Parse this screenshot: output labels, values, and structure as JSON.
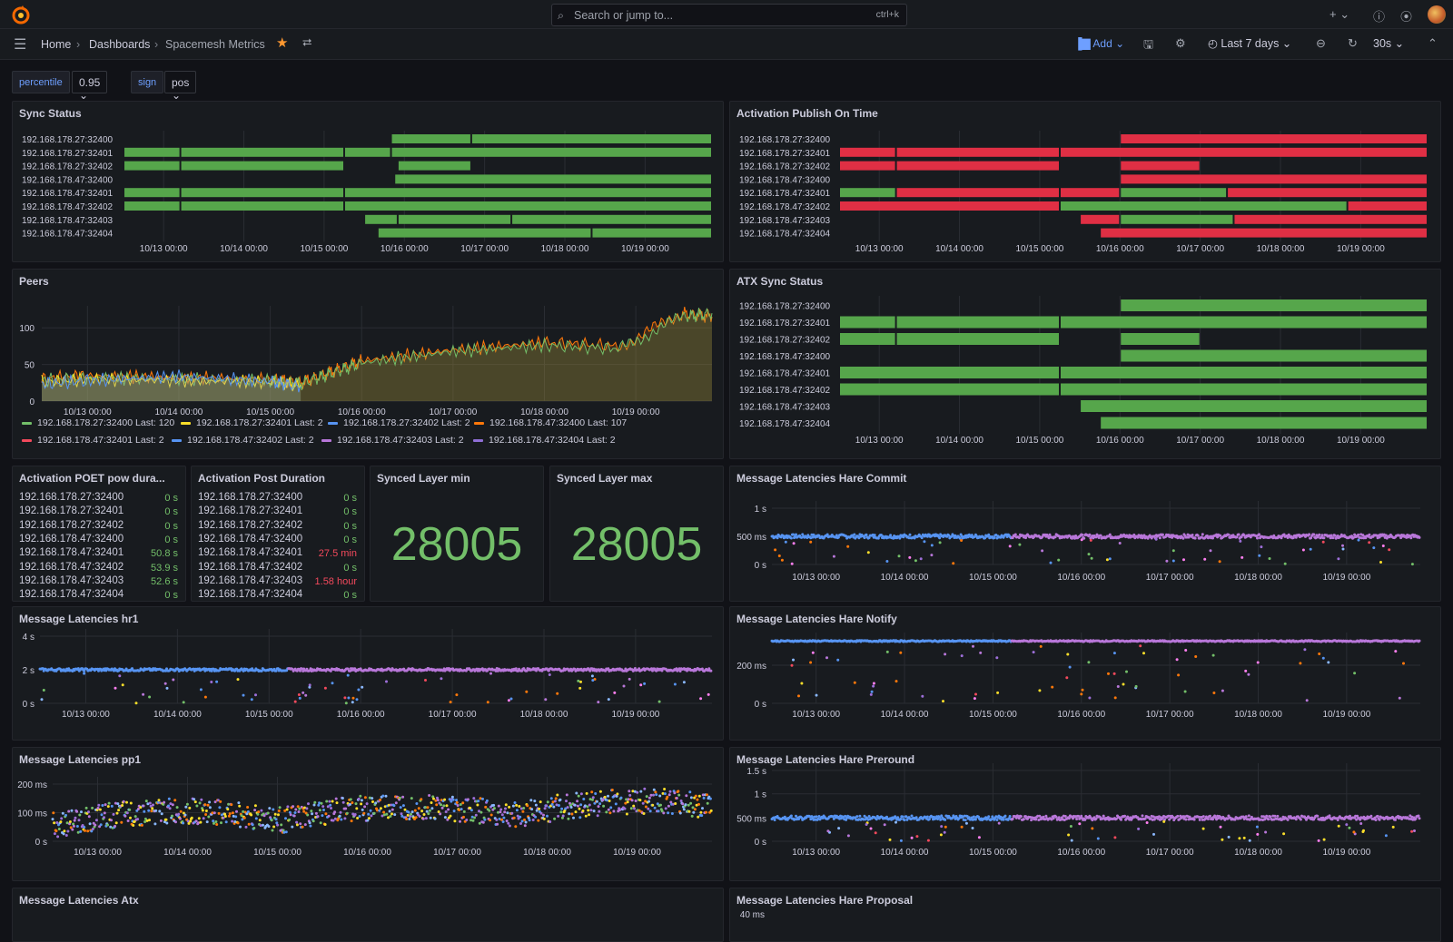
{
  "topbar": {
    "search_placeholder": "Search or jump to...",
    "search_shortcut": "ctrl+k",
    "add_icon": "plus-icon",
    "help_icon": "help-icon",
    "news_icon": "rss-icon"
  },
  "breadcrumb": {
    "home": "Home",
    "dashboards": "Dashboards",
    "current": "Spacemesh Metrics"
  },
  "toolbar": {
    "add_label": "Add",
    "time_range": "Last 7 days",
    "refresh": "30s"
  },
  "variables": [
    {
      "name": "percentile",
      "value": "0.95"
    },
    {
      "name": "sign",
      "value": "pos"
    }
  ],
  "time_ticks": [
    "10/13 00:00",
    "10/14 00:00",
    "10/15 00:00",
    "10/16 00:00",
    "10/17 00:00",
    "10/18 00:00",
    "10/19 00:00"
  ],
  "hosts": [
    "192.168.178.27:32400",
    "192.168.178.27:32401",
    "192.168.178.27:32402",
    "192.168.178.47:32400",
    "192.168.178.47:32401",
    "192.168.178.47:32402",
    "192.168.178.47:32403",
    "192.168.178.47:32404"
  ],
  "panels": {
    "sync_status": {
      "title": "Sync Status",
      "colors": {
        "ok": "#56a64b",
        "bad": "#e02f44"
      }
    },
    "activation_publish": {
      "title": "Activation Publish On Time"
    },
    "peers": {
      "title": "Peers",
      "yticks": [
        "100",
        "50",
        "0"
      ],
      "legend": [
        {
          "label": "192.168.178.27:32400",
          "last": "Last: 120",
          "color": "#73bf69"
        },
        {
          "label": "192.168.178.27:32401",
          "last": "Last: 2",
          "color": "#fade2a"
        },
        {
          "label": "192.168.178.27:32402",
          "last": "Last: 2",
          "color": "#5794f2"
        },
        {
          "label": "192.168.178.47:32400",
          "last": "Last: 107",
          "color": "#ff780a"
        },
        {
          "label": "192.168.178.47:32401",
          "last": "Last: 2",
          "color": "#f2495c"
        },
        {
          "label": "192.168.178.47:32402",
          "last": "Last: 2",
          "color": "#5794f2"
        },
        {
          "label": "192.168.178.47:32403",
          "last": "Last: 2",
          "color": "#b877d9"
        },
        {
          "label": "192.168.178.47:32404",
          "last": "Last: 2",
          "color": "#8f6fd6"
        }
      ]
    },
    "atx_sync": {
      "title": "ATX Sync Status"
    },
    "poet_pow": {
      "title": "Activation POET pow dura...",
      "values": [
        {
          "host": "192.168.178.27:32400",
          "value": "0 s",
          "color": "#73bf69"
        },
        {
          "host": "192.168.178.27:32401",
          "value": "0 s",
          "color": "#73bf69"
        },
        {
          "host": "192.168.178.27:32402",
          "value": "0 s",
          "color": "#73bf69"
        },
        {
          "host": "192.168.178.47:32400",
          "value": "0 s",
          "color": "#73bf69"
        },
        {
          "host": "192.168.178.47:32401",
          "value": "50.8 s",
          "color": "#73bf69"
        },
        {
          "host": "192.168.178.47:32402",
          "value": "53.9 s",
          "color": "#73bf69"
        },
        {
          "host": "192.168.178.47:32403",
          "value": "52.6 s",
          "color": "#73bf69"
        },
        {
          "host": "192.168.178.47:32404",
          "value": "0 s",
          "color": "#73bf69"
        }
      ]
    },
    "post_duration": {
      "title": "Activation Post Duration",
      "values": [
        {
          "host": "192.168.178.27:32400",
          "value": "0 s",
          "color": "#73bf69"
        },
        {
          "host": "192.168.178.27:32401",
          "value": "0 s",
          "color": "#73bf69"
        },
        {
          "host": "192.168.178.27:32402",
          "value": "0 s",
          "color": "#73bf69"
        },
        {
          "host": "192.168.178.47:32400",
          "value": "0 s",
          "color": "#73bf69"
        },
        {
          "host": "192.168.178.47:32401",
          "value": "27.5 min",
          "color": "#f2495c"
        },
        {
          "host": "192.168.178.47:32402",
          "value": "0 s",
          "color": "#73bf69"
        },
        {
          "host": "192.168.178.47:32403",
          "value": "1.58 hour",
          "color": "#f2495c"
        },
        {
          "host": "192.168.178.47:32404",
          "value": "0 s",
          "color": "#73bf69"
        }
      ]
    },
    "synced_min": {
      "title": "Synced Layer min",
      "value": "28005"
    },
    "synced_max": {
      "title": "Synced Layer max",
      "value": "28005"
    },
    "hare_commit": {
      "title": "Message Latencies Hare Commit",
      "yticks": [
        "1 s",
        "500 ms",
        "0 s"
      ]
    },
    "hr1": {
      "title": "Message Latencies hr1",
      "yticks": [
        "4 s",
        "2 s",
        "0 s"
      ]
    },
    "hare_notify": {
      "title": "Message Latencies Hare Notify",
      "yticks": [
        "200 ms",
        "0 s"
      ]
    },
    "pp1": {
      "title": "Message Latencies pp1",
      "yticks": [
        "200 ms",
        "100 ms",
        "0 s"
      ]
    },
    "hare_preround": {
      "title": "Message Latencies Hare Preround",
      "yticks": [
        "1.5 s",
        "1 s",
        "500 ms",
        "0 s"
      ]
    },
    "atx": {
      "title": "Message Latencies Atx"
    },
    "hare_proposal": {
      "title": "Message Latencies Hare Proposal",
      "yticks": [
        "40 ms"
      ]
    }
  },
  "chart_data": [
    {
      "type": "state-timeline",
      "title": "Sync Status",
      "x_range": [
        "10/12 12:00",
        "10/19 20:00"
      ],
      "rows": [
        {
          "name": "192.168.178.27:32400",
          "segments": [
            {
              "from": "10/15 20:00",
              "to": "10/16 20:00",
              "state": "ok"
            },
            {
              "from": "10/16 20:00",
              "to": "10/19 20:00",
              "state": "ok"
            }
          ]
        },
        {
          "name": "192.168.178.27:32401",
          "segments": [
            {
              "from": "10/12 12:00",
              "to": "10/13 05:00",
              "state": "ok"
            },
            {
              "from": "10/13 05:00",
              "to": "10/15 06:00",
              "state": "ok"
            },
            {
              "from": "10/15 06:00",
              "to": "10/15 20:00",
              "state": "ok"
            },
            {
              "from": "10/15 20:00",
              "to": "10/19 20:00",
              "state": "ok"
            }
          ]
        },
        {
          "name": "192.168.178.27:32402",
          "segments": [
            {
              "from": "10/12 12:00",
              "to": "10/13 05:00",
              "state": "ok"
            },
            {
              "from": "10/13 05:00",
              "to": "10/15 06:00",
              "state": "ok"
            },
            {
              "from": "10/15 22:00",
              "to": "10/16 20:00",
              "state": "ok"
            }
          ]
        },
        {
          "name": "192.168.178.47:32400",
          "segments": [
            {
              "from": "10/15 21:00",
              "to": "10/19 20:00",
              "state": "ok"
            }
          ]
        },
        {
          "name": "192.168.178.47:32401",
          "segments": [
            {
              "from": "10/12 12:00",
              "to": "10/13 05:00",
              "state": "ok"
            },
            {
              "from": "10/13 05:00",
              "to": "10/15 06:00",
              "state": "ok"
            },
            {
              "from": "10/15 06:00",
              "to": "10/19 20:00",
              "state": "ok"
            }
          ]
        },
        {
          "name": "192.168.178.47:32402",
          "segments": [
            {
              "from": "10/12 12:00",
              "to": "10/13 05:00",
              "state": "ok"
            },
            {
              "from": "10/13 05:00",
              "to": "10/15 06:00",
              "state": "ok"
            },
            {
              "from": "10/15 06:00",
              "to": "10/19 20:00",
              "state": "ok"
            }
          ]
        },
        {
          "name": "192.168.178.47:32403",
          "segments": [
            {
              "from": "10/15 12:00",
              "to": "10/15 22:00",
              "state": "ok"
            },
            {
              "from": "10/15 22:00",
              "to": "10/17 08:00",
              "state": "ok"
            },
            {
              "from": "10/17 08:00",
              "to": "10/19 20:00",
              "state": "ok"
            }
          ]
        },
        {
          "name": "192.168.178.47:32404",
          "segments": [
            {
              "from": "10/15 16:00",
              "to": "10/18 08:00",
              "state": "ok"
            },
            {
              "from": "10/18 08:00",
              "to": "10/19 20:00",
              "state": "ok"
            }
          ]
        }
      ]
    },
    {
      "type": "state-timeline",
      "title": "Activation Publish On Time",
      "rows": [
        {
          "name": "192.168.178.27:32400",
          "segments": [
            {
              "from": "10/16 00:00",
              "to": "10/19 20:00",
              "state": "bad"
            }
          ]
        },
        {
          "name": "192.168.178.27:32401",
          "segments": [
            {
              "from": "10/12 12:00",
              "to": "10/13 05:00",
              "state": "bad"
            },
            {
              "from": "10/13 05:00",
              "to": "10/15 06:00",
              "state": "bad"
            },
            {
              "from": "10/15 06:00",
              "to": "10/19 20:00",
              "state": "bad"
            }
          ]
        },
        {
          "name": "192.168.178.27:32402",
          "segments": [
            {
              "from": "10/12 12:00",
              "to": "10/13 05:00",
              "state": "bad"
            },
            {
              "from": "10/13 05:00",
              "to": "10/15 06:00",
              "state": "bad"
            },
            {
              "from": "10/16 00:00",
              "to": "10/17 00:00",
              "state": "bad"
            }
          ]
        },
        {
          "name": "192.168.178.47:32400",
          "segments": [
            {
              "from": "10/16 00:00",
              "to": "10/19 20:00",
              "state": "bad"
            }
          ]
        },
        {
          "name": "192.168.178.47:32401",
          "segments": [
            {
              "from": "10/12 12:00",
              "to": "10/13 05:00",
              "state": "ok"
            },
            {
              "from": "10/13 05:00",
              "to": "10/15 06:00",
              "state": "bad"
            },
            {
              "from": "10/15 06:00",
              "to": "10/16 00:00",
              "state": "bad"
            },
            {
              "from": "10/16 00:00",
              "to": "10/17 08:00",
              "state": "ok"
            },
            {
              "from": "10/17 08:00",
              "to": "10/19 20:00",
              "state": "bad"
            }
          ]
        },
        {
          "name": "192.168.178.47:32402",
          "segments": [
            {
              "from": "10/12 12:00",
              "to": "10/15 06:00",
              "state": "bad"
            },
            {
              "from": "10/15 06:00",
              "to": "10/18 20:00",
              "state": "ok"
            },
            {
              "from": "10/18 20:00",
              "to": "10/19 20:00",
              "state": "bad"
            }
          ]
        },
        {
          "name": "192.168.178.47:32403",
          "segments": [
            {
              "from": "10/15 12:00",
              "to": "10/16 00:00",
              "state": "bad"
            },
            {
              "from": "10/16 00:00",
              "to": "10/17 10:00",
              "state": "ok"
            },
            {
              "from": "10/17 10:00",
              "to": "10/19 20:00",
              "state": "bad"
            }
          ]
        },
        {
          "name": "192.168.178.47:32404",
          "segments": [
            {
              "from": "10/15 18:00",
              "to": "10/19 20:00",
              "state": "bad"
            }
          ]
        }
      ]
    },
    {
      "type": "state-timeline",
      "title": "ATX Sync Status",
      "rows": [
        {
          "name": "192.168.178.27:32400",
          "segments": [
            {
              "from": "10/16 00:00",
              "to": "10/19 20:00",
              "state": "ok"
            }
          ]
        },
        {
          "name": "192.168.178.27:32401",
          "segments": [
            {
              "from": "10/12 12:00",
              "to": "10/13 05:00",
              "state": "ok"
            },
            {
              "from": "10/13 05:00",
              "to": "10/15 06:00",
              "state": "ok"
            },
            {
              "from": "10/15 06:00",
              "to": "10/19 20:00",
              "state": "ok"
            }
          ]
        },
        {
          "name": "192.168.178.27:32402",
          "segments": [
            {
              "from": "10/12 12:00",
              "to": "10/13 05:00",
              "state": "ok"
            },
            {
              "from": "10/13 05:00",
              "to": "10/15 06:00",
              "state": "ok"
            },
            {
              "from": "10/16 00:00",
              "to": "10/17 00:00",
              "state": "ok"
            }
          ]
        },
        {
          "name": "192.168.178.47:32400",
          "segments": [
            {
              "from": "10/16 00:00",
              "to": "10/19 20:00",
              "state": "ok"
            }
          ]
        },
        {
          "name": "192.168.178.47:32401",
          "segments": [
            {
              "from": "10/12 12:00",
              "to": "10/15 06:00",
              "state": "ok"
            },
            {
              "from": "10/15 06:00",
              "to": "10/19 20:00",
              "state": "ok"
            }
          ]
        },
        {
          "name": "192.168.178.47:32402",
          "segments": [
            {
              "from": "10/12 12:00",
              "to": "10/15 06:00",
              "state": "ok"
            },
            {
              "from": "10/15 06:00",
              "to": "10/19 20:00",
              "state": "ok"
            }
          ]
        },
        {
          "name": "192.168.178.47:32403",
          "segments": [
            {
              "from": "10/15 12:00",
              "to": "10/19 20:00",
              "state": "ok"
            }
          ]
        },
        {
          "name": "192.168.178.47:32404",
          "segments": [
            {
              "from": "10/15 18:00",
              "to": "10/19 20:00",
              "state": "ok"
            }
          ]
        }
      ]
    },
    {
      "type": "area",
      "title": "Peers",
      "ylim": [
        0,
        130
      ],
      "series": [
        {
          "name": "192.168.178.47:32400",
          "x": [
            "10/12 12:00",
            "10/13 00:00",
            "10/14 00:00",
            "10/15 00:00",
            "10/15 08:00",
            "10/15 16:00",
            "10/16 00:00",
            "10/17 00:00",
            "10/18 00:00",
            "10/18 20:00",
            "10/19 12:00",
            "10/19 20:00"
          ],
          "y": [
            30,
            35,
            32,
            30,
            25,
            40,
            55,
            70,
            80,
            75,
            120,
            115
          ]
        },
        {
          "name": "192.168.178.27:32400",
          "x": [
            "10/12 12:00",
            "10/13 00:00",
            "10/14 00:00",
            "10/15 00:00",
            "10/15 08:00",
            "10/15 16:00",
            "10/16 00:00",
            "10/17 00:00",
            "10/18 00:00",
            "10/18 20:00",
            "10/19 12:00",
            "10/19 20:00"
          ],
          "y": [
            28,
            32,
            30,
            28,
            24,
            38,
            52,
            68,
            76,
            72,
            115,
            120
          ]
        },
        {
          "name": "192.168.178.27:32401",
          "x": [
            "10/12 12:00",
            "10/13 00:00",
            "10/14 00:00",
            "10/15 00:00",
            "10/15 08:00"
          ],
          "y": [
            26,
            30,
            28,
            26,
            22
          ]
        },
        {
          "name": "192.168.178.27:32402",
          "x": [
            "10/12 12:00",
            "10/13 00:00",
            "10/14 00:00",
            "10/15 00:00",
            "10/15 08:00"
          ],
          "y": [
            24,
            28,
            34,
            27,
            20
          ]
        }
      ]
    },
    {
      "type": "scatter",
      "title": "Message Latencies Hare Commit",
      "series": [
        {
          "name": "hosts",
          "typical_ms": [
            450,
            500
          ]
        }
      ]
    },
    {
      "type": "scatter",
      "title": "Message Latencies hr1",
      "series": [
        {
          "name": "hosts",
          "typical_s": [
            2,
            2.1
          ]
        }
      ]
    },
    {
      "type": "scatter",
      "title": "Message Latencies Hare Notify",
      "series": [
        {
          "name": "hosts",
          "typical_ms": [
            280
          ]
        }
      ]
    },
    {
      "type": "scatter",
      "title": "Message Latencies pp1",
      "series": [
        {
          "name": "hosts",
          "typical_ms": [
            50,
            150
          ]
        }
      ]
    },
    {
      "type": "scatter",
      "title": "Message Latencies Hare Preround",
      "series": [
        {
          "name": "hosts",
          "typical_ms": [
            500,
            600
          ]
        }
      ]
    }
  ]
}
